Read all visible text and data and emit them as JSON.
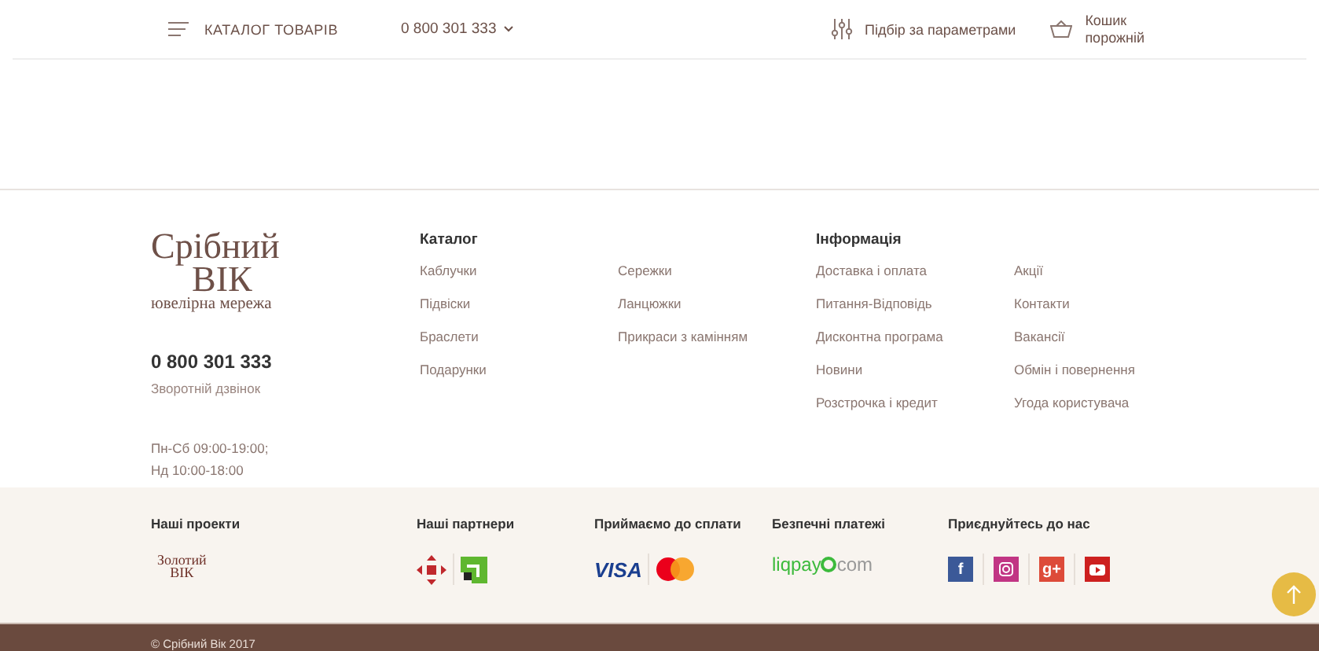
{
  "header": {
    "catalog_button": "КАТАЛОГ ТОВАРІВ",
    "phone": "0 800 301 333",
    "filter_link": "Підбір за параметрами",
    "cart": {
      "title": "Кошик",
      "status": "порожній"
    }
  },
  "footer": {
    "logo": {
      "line1": "Срібний",
      "line2": "ВІК",
      "tagline": "ювелірна мережа"
    },
    "phone": "0 800 301 333",
    "callback": "Зворотній дзвінок",
    "hours": [
      "Пн-Сб 09:00-19:00;",
      "Нд 10:00-18:00"
    ],
    "columns": [
      {
        "title": "Каталог",
        "links": [
          [
            "Каблучки",
            "Підвіски",
            "Браслети",
            "Подарунки"
          ],
          [
            "Сережки",
            "Ланцюжки",
            "Прикраси з камінням"
          ]
        ]
      },
      {
        "title": "Інформація",
        "links": [
          [
            "Доставка і оплата",
            "Питання-Відповідь",
            "Дисконтна програма",
            "Новини",
            "Розстрочка і кредит"
          ],
          [
            "Акції",
            "Контакти",
            "Вакансії",
            "Обмін і повернення",
            "Угода користувача"
          ]
        ]
      }
    ],
    "bottom": [
      {
        "title": "Наші проекти",
        "kind": "projects",
        "logo": {
          "line1": "Золотий",
          "line2": "ВІК"
        }
      },
      {
        "title": "Наші партнери",
        "kind": "partners"
      },
      {
        "title": "Приймаємо до сплати",
        "kind": "payments",
        "visa": "VISA"
      },
      {
        "title": "Безпечні платежі",
        "kind": "secure",
        "brand": "liqpay",
        "suffix": "com"
      },
      {
        "title": "Приєднуйтесь до нас",
        "kind": "social",
        "networks": [
          {
            "kind": "facebook",
            "glyph": "f",
            "color": "#3b5998"
          },
          {
            "kind": "instagram",
            "color": "#c13584"
          },
          {
            "kind": "google",
            "glyph": "g+",
            "color": "#dd4b39"
          },
          {
            "kind": "youtube",
            "color": "#cd201f"
          }
        ]
      }
    ],
    "copyright": "© Срібний Вік 2017"
  }
}
